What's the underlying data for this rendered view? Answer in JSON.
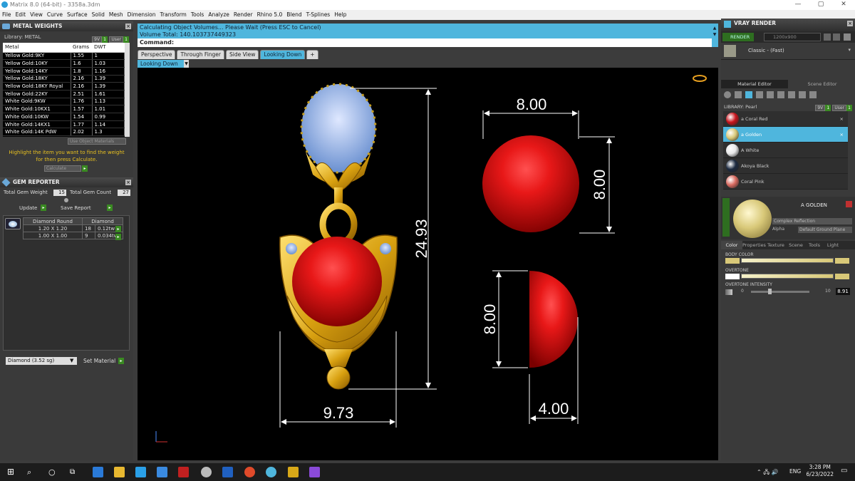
{
  "window": {
    "title": "Matrix 8.0 (64-bit) - 3358a.3dm",
    "min": "—",
    "max": "▢",
    "close": "✕"
  },
  "menu": [
    "File",
    "Edit",
    "View",
    "Curve",
    "Surface",
    "Solid",
    "Mesh",
    "Dimension",
    "Transform",
    "Tools",
    "Analyze",
    "Render",
    "Rhino 5.0",
    "Blend",
    "T-Splines",
    "Help"
  ],
  "metal_weights": {
    "title": "METAL WEIGHTS",
    "library_label": "Library: METAL",
    "btn_9v": "9V",
    "btn_user": "User",
    "columns": [
      "Metal",
      "Grams",
      "DWT"
    ],
    "rows": [
      [
        "Yellow Gold:9KY",
        "1.55",
        "1"
      ],
      [
        "Yellow Gold:10KY",
        "1.6",
        "1.03"
      ],
      [
        "Yellow Gold:14KY",
        "1.8",
        "1.16"
      ],
      [
        "Yellow Gold:18KY",
        "2.16",
        "1.39"
      ],
      [
        "Yellow Gold:18KY Royal",
        "2.16",
        "1.39"
      ],
      [
        "Yellow Gold:22KY",
        "2.51",
        "1.61"
      ],
      [
        "White Gold:9KW",
        "1.76",
        "1.13"
      ],
      [
        "White Gold:10KX1",
        "1.57",
        "1.01"
      ],
      [
        "White Gold:10KW",
        "1.54",
        "0.99"
      ],
      [
        "White Gold:14KX1",
        "1.77",
        "1.14"
      ],
      [
        "White Gold:14K PdW",
        "2.02",
        "1.3"
      ]
    ],
    "use_object_materials": "Use Object Materials",
    "hint": "Highlight the item you want to find the weight for then press Calculate.",
    "calculate": "Calculate"
  },
  "gem_reporter": {
    "title": "GEM REPORTER",
    "total_weight_label": "Total Gem Weight",
    "total_weight": "15",
    "total_count_label": "Total Gem Count",
    "total_count": "27",
    "update": "Update",
    "save_report": "Save Report",
    "columns": [
      "Diamond Round",
      "Diamond"
    ],
    "rows": [
      [
        "1.20 X 1.20",
        "18",
        "0.12tw"
      ],
      [
        "1.00 X 1.00",
        "9",
        "0.034tw"
      ]
    ],
    "material_select": "Diamond   (3.52 sg)",
    "set_material": "Set Material"
  },
  "status": {
    "line1": "Calculating Object Volumes... Please Wait (Press ESC to Cancel)",
    "line2": "Volume Total: 140.103737449323",
    "command_label": "Command:"
  },
  "view_tabs": [
    "Perspective",
    "Through Finger",
    "Side View",
    "Looking Down"
  ],
  "active_view": "Looking Down",
  "dimensions": {
    "height": "24.93",
    "width": "9.73",
    "ball_w": "8.00",
    "ball_h": "8.00",
    "half_h": "8.00",
    "half_w": "4.00"
  },
  "vray": {
    "title": "VRAY RENDER",
    "render": "RENDER",
    "resolution": "1200x900",
    "quality": "Classic - (Fast)",
    "tabs": [
      "Material Editor",
      "Scene Editor"
    ],
    "library_label": "LIBRARY: Pearl",
    "materials": [
      {
        "name": "a Coral Red",
        "color": "#c8141c"
      },
      {
        "name": "a Golden",
        "color": "#d8c878"
      },
      {
        "name": "A White",
        "color": "#e8e8e8"
      },
      {
        "name": "Akoya Black",
        "color": "#1c2a40"
      },
      {
        "name": "Coral Pink",
        "color": "#d86a60"
      }
    ],
    "selected_name": "A GOLDEN",
    "complex_reflection": "Complex Reflection",
    "alpha": "Alpha",
    "ground_plane": "Default Ground Plane",
    "prop_tabs": [
      "Color",
      "Properties",
      "Texture",
      "Scene",
      "Tools",
      "Light"
    ],
    "body_color": "BODY COLOR",
    "overtone": "OVERTONE",
    "overtone_intensity": "OVERTONE INTENSITY",
    "intensity_min": "0",
    "intensity_max": "10",
    "intensity_value": "8.91"
  },
  "taskbar": {
    "lang": "ENG",
    "time": "3:28 PM",
    "date": "6/23/2022"
  },
  "colors": {
    "accent": "#4fb6dd",
    "gold": "#d8a818",
    "pearl_red": "#c8141c"
  }
}
